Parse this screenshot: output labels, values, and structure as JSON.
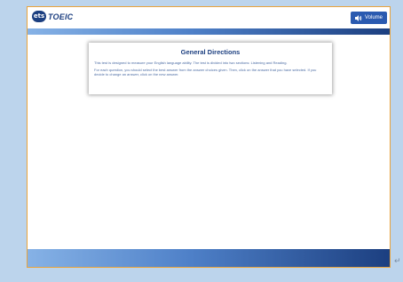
{
  "header": {
    "logo_mark": "ets",
    "logo_text": "TOEIC",
    "volume_label": "Volume",
    "volume_icon": "speaker-icon"
  },
  "directions": {
    "title": "General Directions",
    "paragraph_1": "This test is designed to measure your English language ability. The test is divided into two sections: Listening and Reading.",
    "paragraph_2": "For each question, you should select the best answer from the answer choices given. Then, click on the answer that you have selected. If you decide to change an answer, click on the new answer."
  },
  "colors": {
    "brand_navy": "#1c3f80",
    "brand_blue": "#2a5ab0",
    "window_border": "#e9a33a",
    "background": "#bcd4ec"
  }
}
